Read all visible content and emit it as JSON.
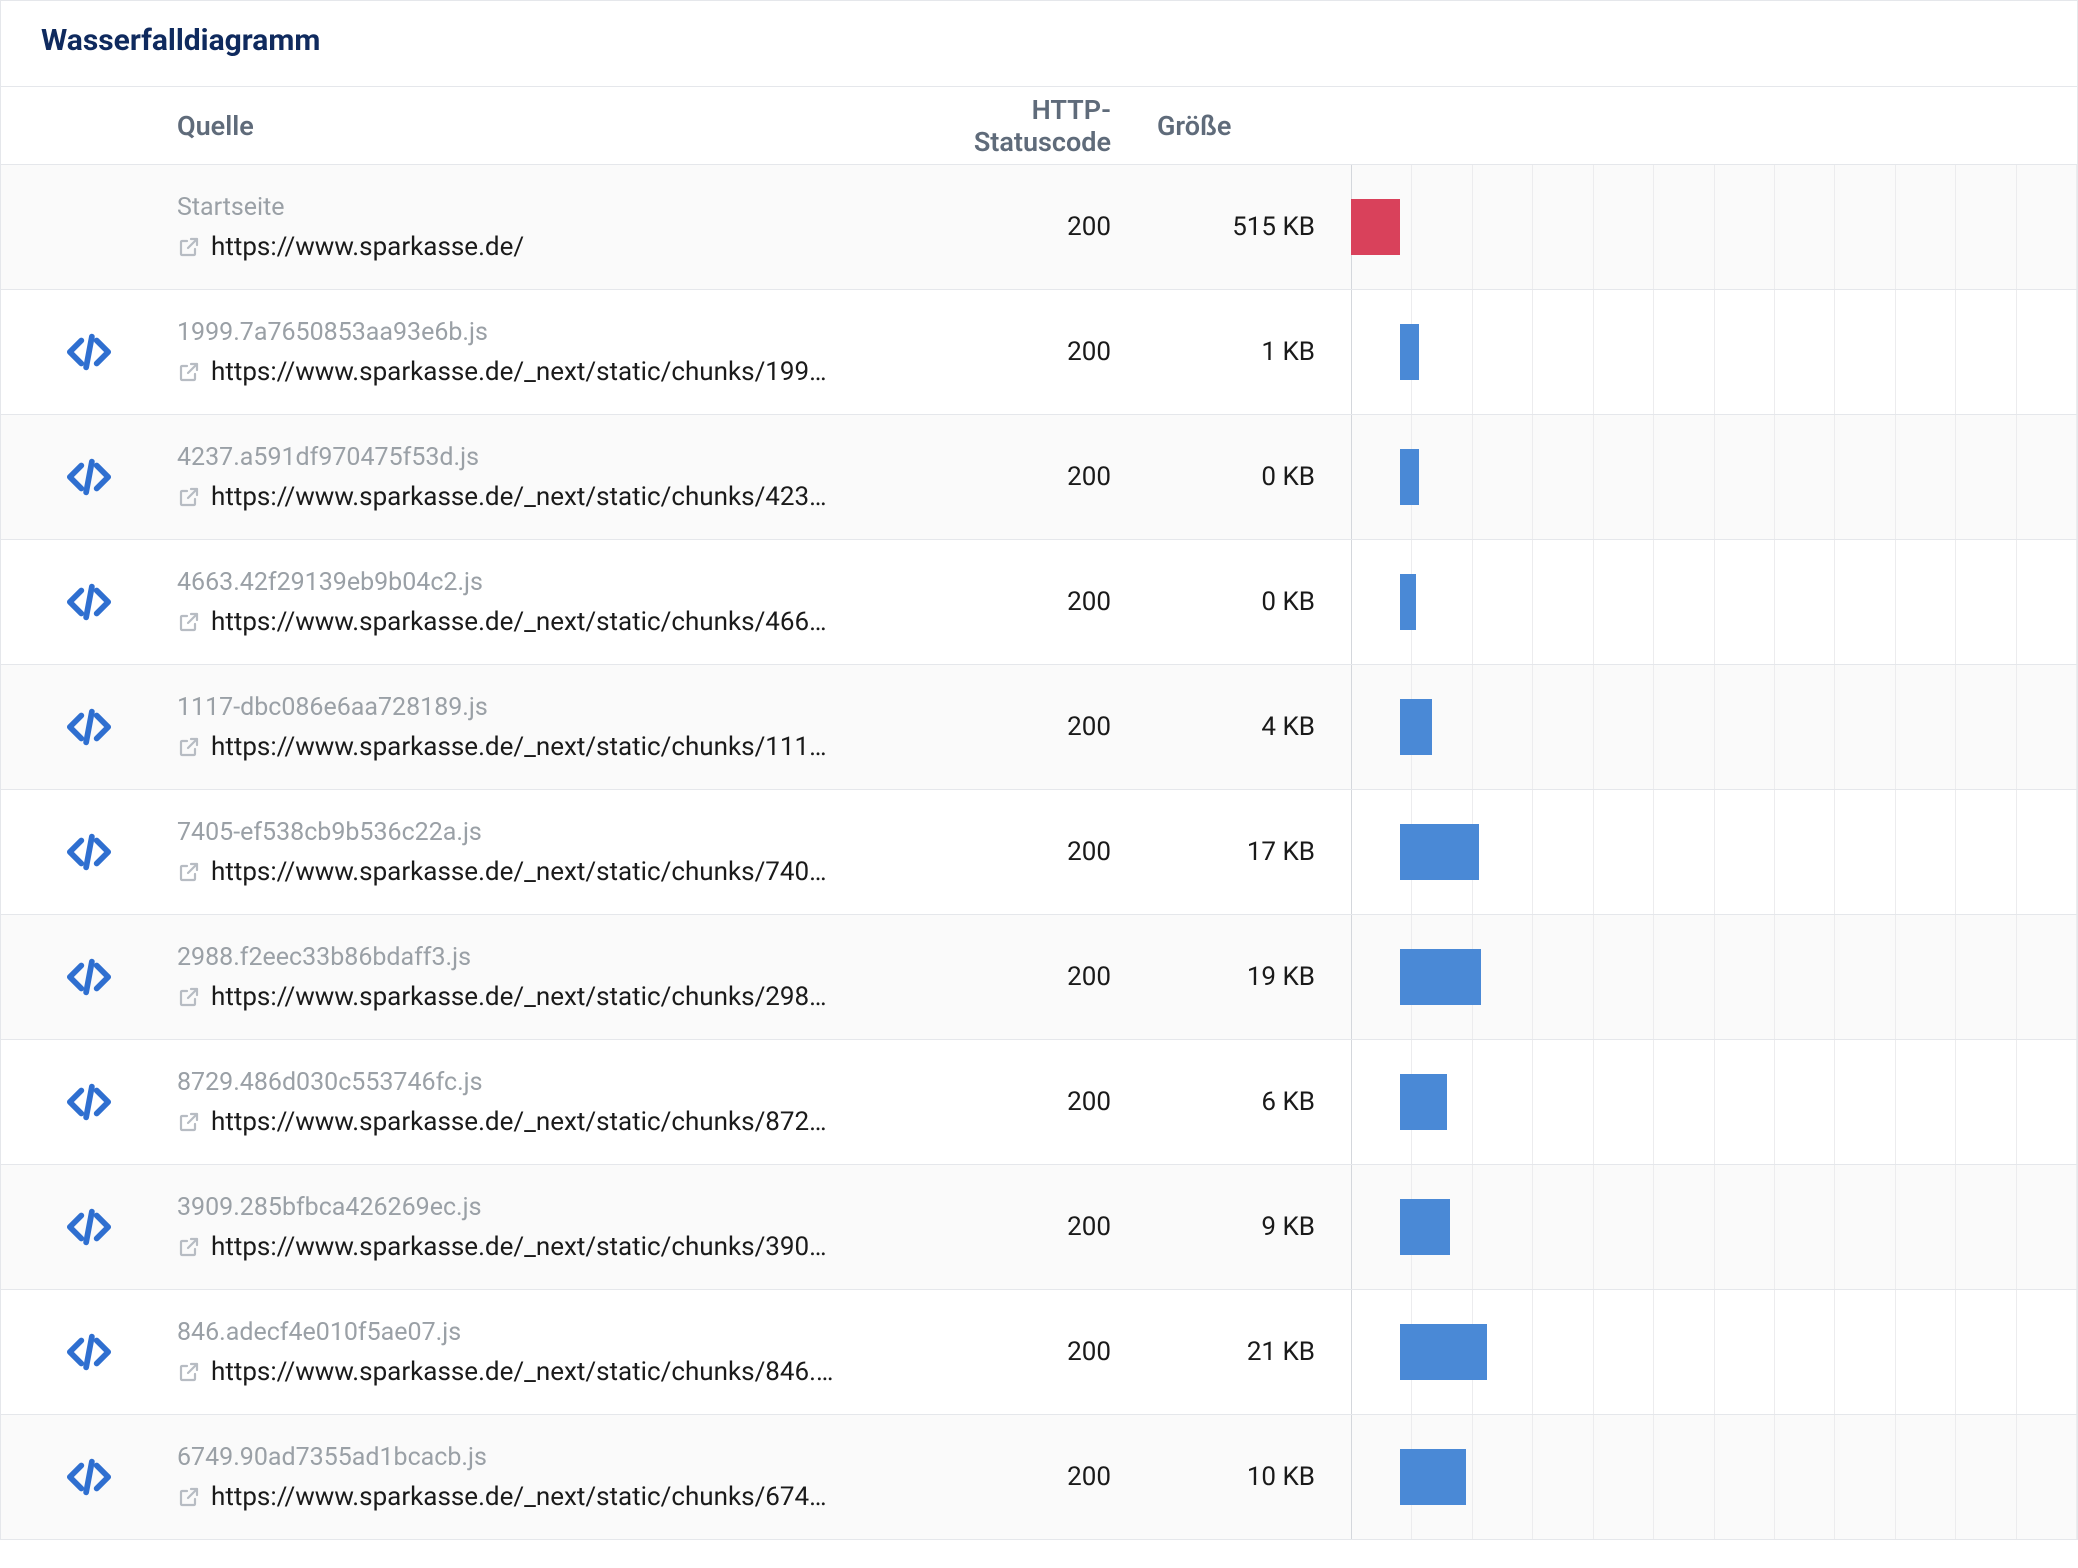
{
  "title": "Wasserfalldiagramm",
  "columns": {
    "source": "Quelle",
    "status": "HTTP-Statuscode",
    "size": "Größe"
  },
  "chart_data": {
    "type": "bar",
    "title": "Wasserfalldiagramm",
    "xlabel": "",
    "ylabel": "",
    "categories": [
      "Startseite",
      "1999.7a7650853aa93e6b.js",
      "4237.a591df970475f53d.js",
      "4663.42f29139eb9b04c2.js",
      "1117-dbc086e6aa728189.js",
      "7405-ef538cb9b536c22a.js",
      "2988.f2eec33b86bdaff3.js",
      "8729.486d030c553746fc.js",
      "3909.285bfbca426269ec.js",
      "846.adecf4e010f5ae07.js",
      "6749.90ad7355ad1bcacb.js"
    ],
    "series": [
      {
        "name": "start_ms",
        "values": [
          0,
          490,
          490,
          490,
          490,
          490,
          490,
          490,
          490,
          490,
          490
        ]
      },
      {
        "name": "duration_ms",
        "values": [
          490,
          180,
          180,
          160,
          320,
          780,
          800,
          460,
          500,
          860,
          650
        ]
      },
      {
        "name": "size_kb",
        "values": [
          515,
          1,
          0,
          0,
          4,
          17,
          19,
          6,
          9,
          21,
          10
        ]
      }
    ],
    "xlim_ms": [
      0,
      7200
    ]
  },
  "rows": [
    {
      "type": "page",
      "title": "Startseite",
      "url": "https://www.sparkasse.de/",
      "status": "200",
      "size": "515 KB",
      "bar": {
        "start_pct": 0,
        "width_pct": 6.8,
        "color": "red"
      }
    },
    {
      "type": "script",
      "title": "1999.7a7650853aa93e6b.js",
      "url": "https://www.sparkasse.de/_next/static/chunks/199…",
      "status": "200",
      "size": "1 KB",
      "bar": {
        "start_pct": 6.8,
        "width_pct": 2.5,
        "color": "blue"
      }
    },
    {
      "type": "script",
      "title": "4237.a591df970475f53d.js",
      "url": "https://www.sparkasse.de/_next/static/chunks/423…",
      "status": "200",
      "size": "0 KB",
      "bar": {
        "start_pct": 6.8,
        "width_pct": 2.5,
        "color": "blue"
      }
    },
    {
      "type": "script",
      "title": "4663.42f29139eb9b04c2.js",
      "url": "https://www.sparkasse.de/_next/static/chunks/466…",
      "status": "200",
      "size": "0 KB",
      "bar": {
        "start_pct": 6.8,
        "width_pct": 2.2,
        "color": "blue"
      }
    },
    {
      "type": "script",
      "title": "1117-dbc086e6aa728189.js",
      "url": "https://www.sparkasse.de/_next/static/chunks/111…",
      "status": "200",
      "size": "4 KB",
      "bar": {
        "start_pct": 6.8,
        "width_pct": 4.4,
        "color": "blue"
      }
    },
    {
      "type": "script",
      "title": "7405-ef538cb9b536c22a.js",
      "url": "https://www.sparkasse.de/_next/static/chunks/740…",
      "status": "200",
      "size": "17 KB",
      "bar": {
        "start_pct": 6.8,
        "width_pct": 10.8,
        "color": "blue"
      }
    },
    {
      "type": "script",
      "title": "2988.f2eec33b86bdaff3.js",
      "url": "https://www.sparkasse.de/_next/static/chunks/298…",
      "status": "200",
      "size": "19 KB",
      "bar": {
        "start_pct": 6.8,
        "width_pct": 11.1,
        "color": "blue"
      }
    },
    {
      "type": "script",
      "title": "8729.486d030c553746fc.js",
      "url": "https://www.sparkasse.de/_next/static/chunks/872…",
      "status": "200",
      "size": "6 KB",
      "bar": {
        "start_pct": 6.8,
        "width_pct": 6.4,
        "color": "blue"
      }
    },
    {
      "type": "script",
      "title": "3909.285bfbca426269ec.js",
      "url": "https://www.sparkasse.de/_next/static/chunks/390…",
      "status": "200",
      "size": "9 KB",
      "bar": {
        "start_pct": 6.8,
        "width_pct": 6.9,
        "color": "blue"
      }
    },
    {
      "type": "script",
      "title": "846.adecf4e010f5ae07.js",
      "url": "https://www.sparkasse.de/_next/static/chunks/846.…",
      "status": "200",
      "size": "21 KB",
      "bar": {
        "start_pct": 6.8,
        "width_pct": 11.9,
        "color": "blue"
      }
    },
    {
      "type": "script",
      "title": "6749.90ad7355ad1bcacb.js",
      "url": "https://www.sparkasse.de/_next/static/chunks/674…",
      "status": "200",
      "size": "10 KB",
      "bar": {
        "start_pct": 6.8,
        "width_pct": 9.0,
        "color": "blue"
      }
    }
  ]
}
